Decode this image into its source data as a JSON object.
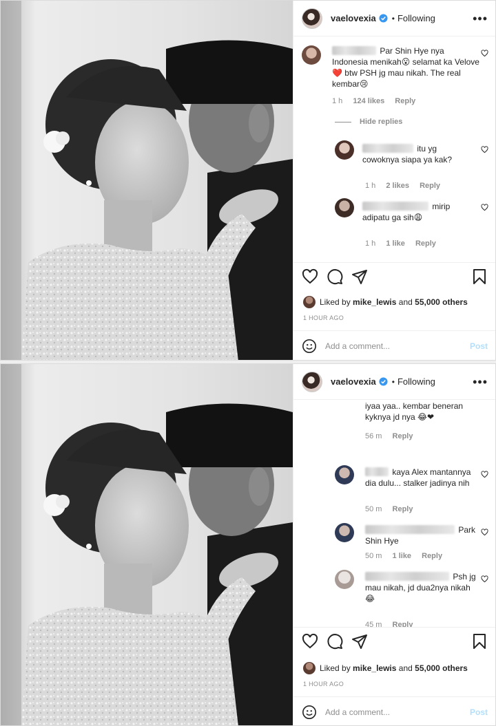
{
  "post": {
    "username": "vaelovexia",
    "separator": "•",
    "following_label": "Following",
    "more_icon": "•••",
    "liked_prefix": "Liked by",
    "liked_user": "mike_lewis",
    "liked_and": "and",
    "liked_count": "55,000 others",
    "time_ago": "1 HOUR AGO",
    "add_comment_placeholder": "Add a comment...",
    "post_label": "Post",
    "icons": [
      "heart-icon",
      "comment-icon",
      "share-icon",
      "bookmark-icon",
      "emoji-icon",
      "verified-badge-icon",
      "more-options-icon"
    ],
    "colors": {
      "verified": "#3897f0",
      "post_disabled": "#b2dffc",
      "meta_text": "#8e8e8e"
    }
  },
  "top": {
    "c1": {
      "text": "Par Shin Hye nya Indonesia menikah😮 selamat ka Velove❤️ btw PSH jg mau nikah. The real kembar😢",
      "time": "1 h",
      "likes": "124 likes",
      "reply": "Reply"
    },
    "hide_replies": "Hide replies",
    "c2": {
      "text": "itu yg cowoknya siapa ya kak?",
      "time": "1 h",
      "likes": "2 likes",
      "reply": "Reply"
    },
    "c3": {
      "text": "mirip adipatu ga sih😩",
      "time": "1 h",
      "likes": "1 like",
      "reply": "Reply"
    }
  },
  "bottom": {
    "c1": {
      "text": "iyaa yaa.. kembar beneran kyknya jd nya 😂❤",
      "time": "56 m",
      "reply": "Reply"
    },
    "c2": {
      "text": "kaya Alex mantannya dia dulu... stalker jadinya nih",
      "time": "50 m",
      "reply": "Reply"
    },
    "c3": {
      "text": "Park Shin Hye",
      "time": "50 m",
      "likes": "1 like",
      "reply": "Reply"
    },
    "c4": {
      "text": "Psh jg mau nikah, jd dua2nya nikah 😂",
      "time": "45 m",
      "reply": "Reply"
    }
  }
}
